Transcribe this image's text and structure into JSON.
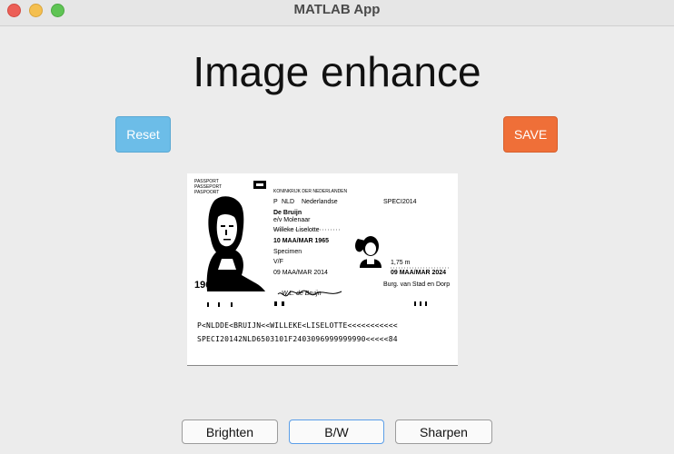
{
  "window": {
    "title": "MATLAB App"
  },
  "heading": "Image enhance",
  "buttons": {
    "reset": "Reset",
    "save": "SAVE"
  },
  "passport": {
    "doc_lines": [
      "PASSPORT",
      "PASSEPORT",
      "PASPOORT"
    ],
    "country_header": "KONINKRIJK DER NEDERLANDEN",
    "type_code": "P",
    "nationality_code": "NLD",
    "country": "Nederlandse",
    "doc_number": "SPECI2014",
    "surname": "De Bruijn",
    "spouse": "e/v Molenaar",
    "given_names": "Willeke Liselotte",
    "birth_date": "10 MAA/MAR 1965",
    "birth_place": "Specimen",
    "sex": "V/F",
    "issue_date": "09 MAA/MAR 2014",
    "height": "1,75 m",
    "expiry_date": "09 MAA/MAR 2024",
    "authority": "Burg. van Stad en Dorp",
    "year_overlay": "1965",
    "signature": "W.L. de Bruijn",
    "mrz_line1": "P<NLDDE<BRUIJN<<WILLEKE<LISELOTTE<<<<<<<<<<<",
    "mrz_line2": "SPECI20142NLD6503101F2403096999999990<<<<<84"
  },
  "toolbar": {
    "brighten": "Brighten",
    "bw": "B/W",
    "sharpen": "Sharpen"
  },
  "colors": {
    "reset": "#6cbde8",
    "save": "#ef6f38",
    "active_border": "#5b9ee8"
  }
}
